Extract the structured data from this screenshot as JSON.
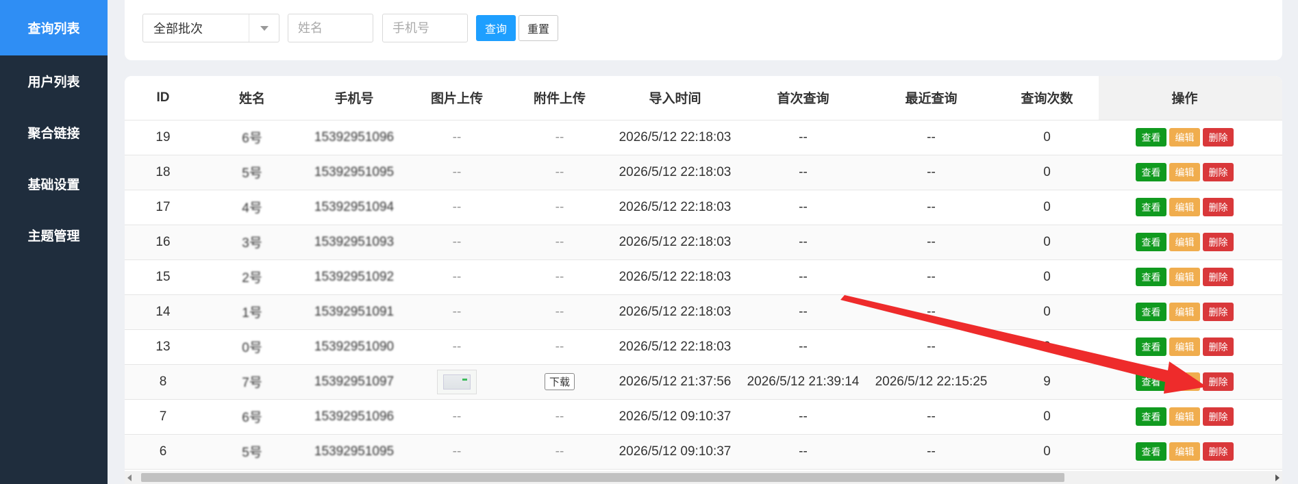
{
  "sidebar": {
    "items": [
      {
        "label": "查询列表",
        "active": true
      },
      {
        "label": "用户列表"
      },
      {
        "label": "聚合链接"
      },
      {
        "label": "基础设置"
      },
      {
        "label": "主题管理"
      }
    ]
  },
  "filters": {
    "batch_select": "全部批次",
    "name_placeholder": "姓名",
    "phone_placeholder": "手机号",
    "query_label": "查询",
    "reset_label": "重置"
  },
  "table": {
    "headers": [
      "ID",
      "姓名",
      "手机号",
      "图片上传",
      "附件上传",
      "导入时间",
      "首次查询",
      "最近查询",
      "查询次数",
      "操作"
    ],
    "rows": [
      {
        "id": "19",
        "name": "6号",
        "phone": "15392951096",
        "img": "--",
        "att": "--",
        "import_time": "2026/5/12 22:18:03",
        "first": "--",
        "last": "--",
        "count": "0"
      },
      {
        "id": "18",
        "name": "5号",
        "phone": "15392951095",
        "img": "--",
        "att": "--",
        "import_time": "2026/5/12 22:18:03",
        "first": "--",
        "last": "--",
        "count": "0"
      },
      {
        "id": "17",
        "name": "4号",
        "phone": "15392951094",
        "img": "--",
        "att": "--",
        "import_time": "2026/5/12 22:18:03",
        "first": "--",
        "last": "--",
        "count": "0"
      },
      {
        "id": "16",
        "name": "3号",
        "phone": "15392951093",
        "img": "--",
        "att": "--",
        "import_time": "2026/5/12 22:18:03",
        "first": "--",
        "last": "--",
        "count": "0"
      },
      {
        "id": "15",
        "name": "2号",
        "phone": "15392951092",
        "img": "--",
        "att": "--",
        "import_time": "2026/5/12 22:18:03",
        "first": "--",
        "last": "--",
        "count": "0"
      },
      {
        "id": "14",
        "name": "1号",
        "phone": "15392951091",
        "img": "--",
        "att": "--",
        "import_time": "2026/5/12 22:18:03",
        "first": "--",
        "last": "--",
        "count": "0"
      },
      {
        "id": "13",
        "name": "0号",
        "phone": "15392951090",
        "img": "--",
        "att": "--",
        "import_time": "2026/5/12 22:18:03",
        "first": "--",
        "last": "--",
        "count": "0"
      },
      {
        "id": "8",
        "name": "7号",
        "phone": "15392951097",
        "img": "thumbnail",
        "att": "下载",
        "import_time": "2026/5/12 21:37:56",
        "first": "2026/5/12 21:39:14",
        "last": "2026/5/12 22:15:25",
        "count": "9"
      },
      {
        "id": "7",
        "name": "6号",
        "phone": "15392951096",
        "img": "--",
        "att": "--",
        "import_time": "2026/5/12 09:10:37",
        "first": "--",
        "last": "--",
        "count": "0"
      },
      {
        "id": "6",
        "name": "5号",
        "phone": "15392951095",
        "img": "--",
        "att": "--",
        "import_time": "2026/5/12 09:10:37",
        "first": "--",
        "last": "--",
        "count": "0"
      }
    ],
    "actions": {
      "view": "查看",
      "edit": "编辑",
      "delete": "删除"
    }
  },
  "colors": {
    "sidebar_bg": "#1f2d3d",
    "active_item": "#2f8ef4",
    "query_btn": "#1e9fff",
    "view_btn": "#109a1f",
    "edit_btn": "#f0ad4e",
    "delete_btn": "#d9383a",
    "annotation_arrow": "#ee2b2b"
  }
}
